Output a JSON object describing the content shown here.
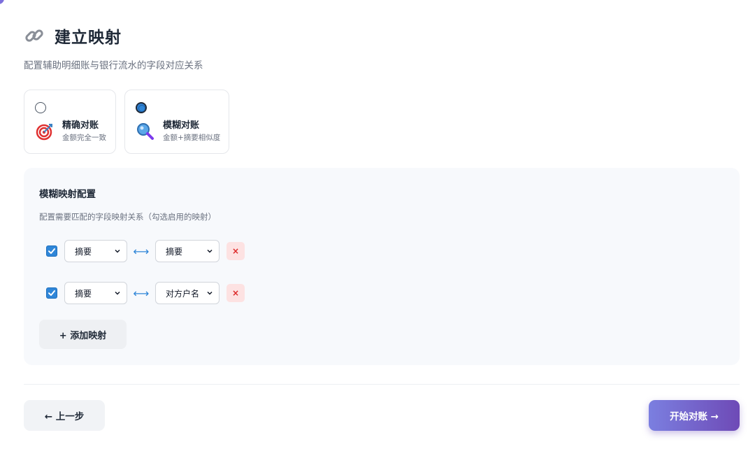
{
  "header": {
    "title": "建立映射",
    "subtitle": "配置辅助明细账与银行流水的字段对应关系",
    "icon": "link-icon"
  },
  "modes": [
    {
      "name": "精确对账",
      "desc": "金额完全一致",
      "icon": "target-icon",
      "selected": false
    },
    {
      "name": "模糊对账",
      "desc": "金额+摘要相似度",
      "icon": "magnifier-icon",
      "selected": true
    }
  ],
  "config": {
    "title": "模糊映射配置",
    "desc": "配置需要匹配的字段映射关系（勾选启用的映射）",
    "mappings": [
      {
        "enabled": true,
        "left": "摘要",
        "connector": "⟷",
        "right": "摘要",
        "remove": "×"
      },
      {
        "enabled": true,
        "left": "摘要",
        "connector": "⟷",
        "right": "对方户名",
        "remove": "×"
      }
    ],
    "add_label": "+ 添加映射"
  },
  "footer": {
    "prev_label": "← 上一步",
    "start_label": "开始对账 →"
  },
  "colors": {
    "accent": "#2f86d8",
    "primary_gradient_start": "#7b7fe0",
    "primary_gradient_end": "#6e4ab6",
    "danger_bg": "#fde2e2",
    "danger": "#dc2626"
  }
}
